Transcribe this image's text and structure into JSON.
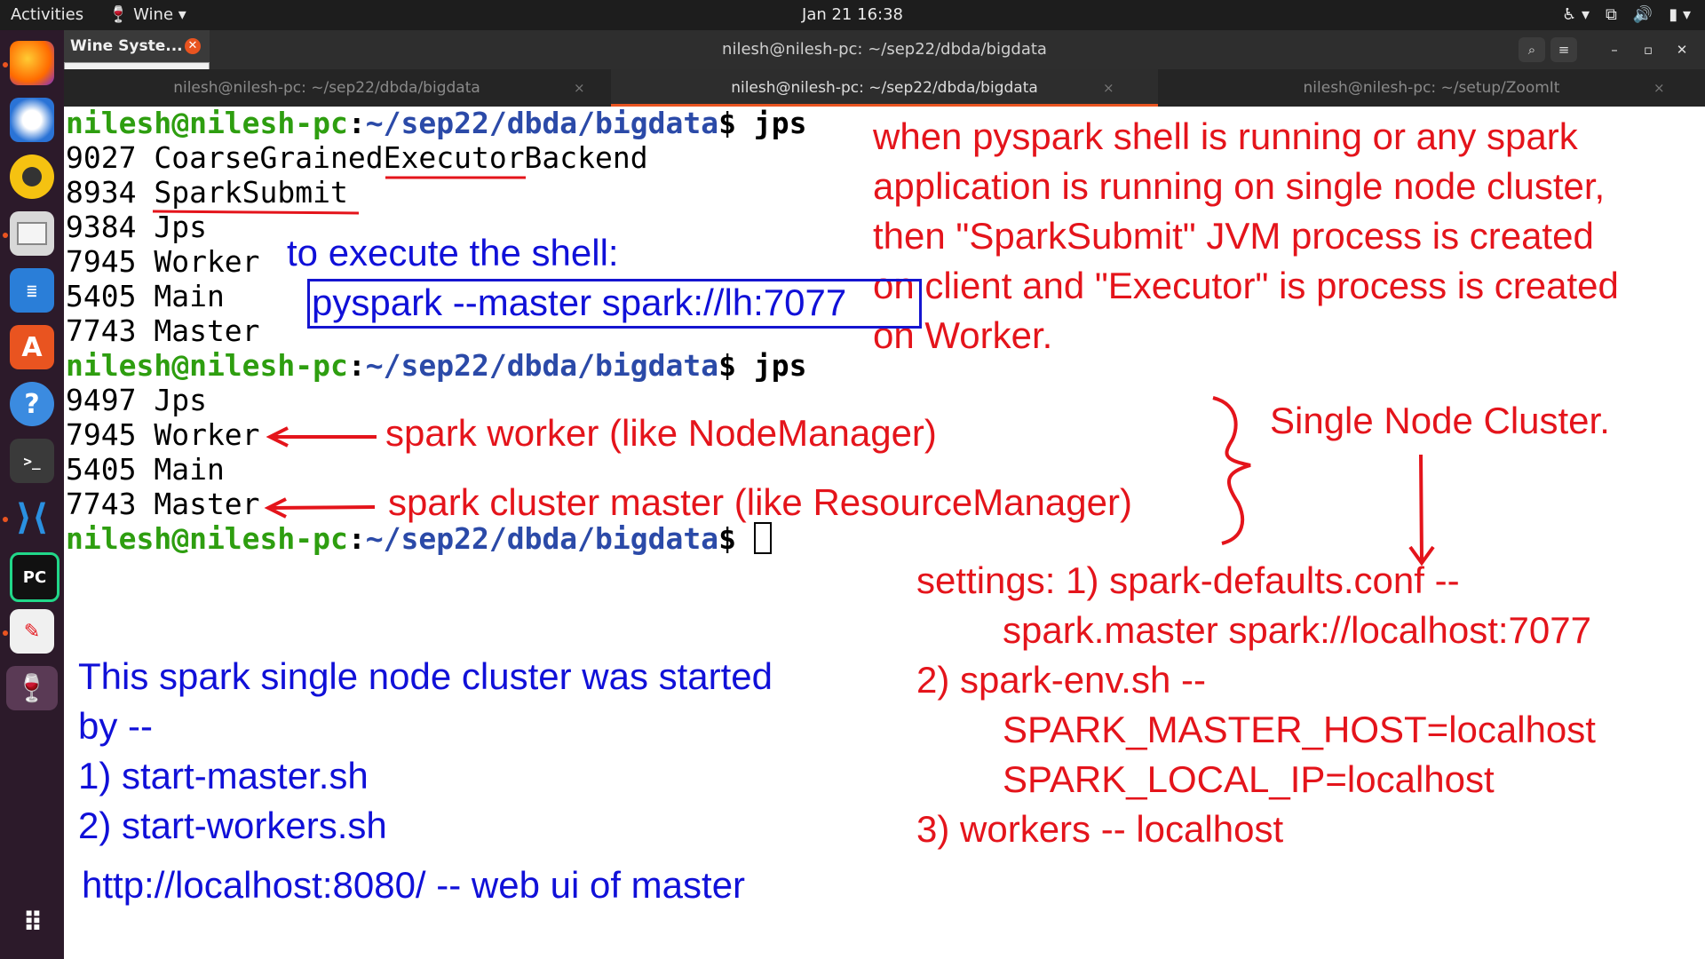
{
  "topbar": {
    "activities": "Activities",
    "app_menu": "Wine",
    "clock": "Jan 21  16:38"
  },
  "window": {
    "wine_tab": "Wine Syste...",
    "title": "nilesh@nilesh-pc: ~/sep22/dbda/bigdata"
  },
  "tabs": [
    {
      "label": "nilesh@nilesh-pc: ~/sep22/dbda/bigdata"
    },
    {
      "label": "nilesh@nilesh-pc: ~/sep22/dbda/bigdata"
    },
    {
      "label": "nilesh@nilesh-pc: ~/setup/ZoomIt"
    }
  ],
  "terminal": {
    "user": "nilesh@nilesh-pc",
    "path": "~/sep22/dbda/bigdata",
    "prompt_symbol": "$",
    "command1": "jps",
    "output1": [
      "9027 CoarseGrainedExecutorBackend",
      "8934 SparkSubmit",
      "9384 Jps",
      "7945 Worker",
      "5405 Main",
      "7743 Master"
    ],
    "command2": "jps",
    "output2": [
      "9497 Jps",
      "7945 Worker",
      "5405 Main",
      "7743 Master"
    ]
  },
  "annotations": {
    "top_right": [
      "when pyspark shell is running or any spark",
      "application is running on single node cluster,",
      "then \"SparkSubmit\" JVM process is created",
      "on client and \"Executor\" is process is created",
      "on Worker."
    ],
    "shell_label": "to execute the shell:",
    "shell_command": "pyspark --master spark://lh:7077",
    "worker_note": "spark worker (like NodeManager)",
    "master_note": "spark cluster master (like ResourceManager)",
    "cluster_label": "Single Node Cluster.",
    "settings": [
      "settings: 1) spark-defaults.conf --",
      "spark.master  spark://localhost:7077",
      "2) spark-env.sh --",
      "SPARK_MASTER_HOST=localhost",
      "SPARK_LOCAL_IP=localhost",
      "3) workers -- localhost"
    ],
    "started": [
      "This spark single node cluster was started",
      "by --",
      "1) start-master.sh",
      "2) start-workers.sh"
    ],
    "webui": "http://localhost:8080/ -- web ui of master"
  },
  "icons": [
    "firefox-icon",
    "thunderbird-icon",
    "rhythmbox-icon",
    "files-icon",
    "writer-icon",
    "software-icon",
    "help-icon",
    "terminal-icon",
    "vscode-icon",
    "pycharm-icon",
    "text-editor-icon",
    "wine-icon",
    "app-grid-icon"
  ]
}
